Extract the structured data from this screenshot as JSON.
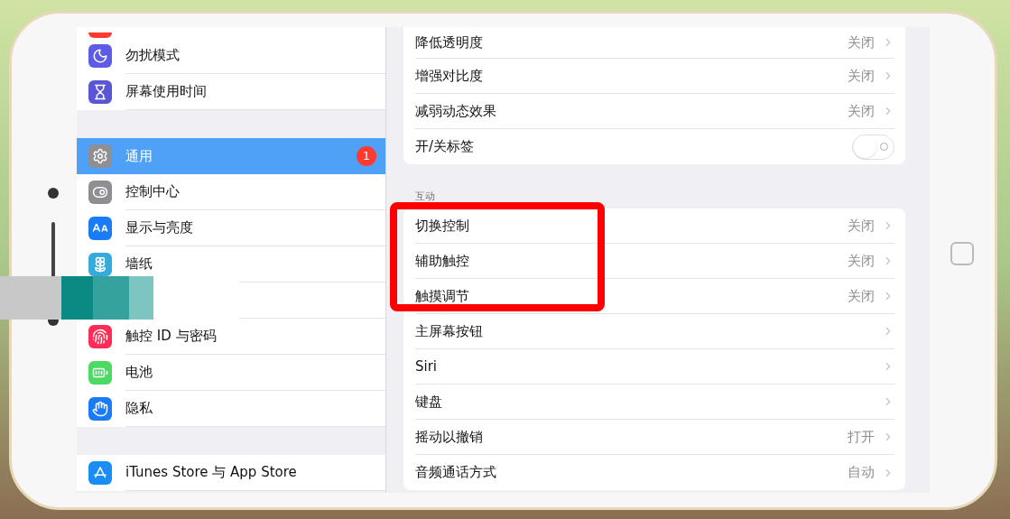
{
  "sidebar": {
    "groups": [
      {
        "items": [
          {
            "selected": false
          },
          {
            "label": "勿扰模式",
            "selected": false
          },
          {
            "label": "屏幕使用时间",
            "selected": false
          }
        ]
      },
      {
        "items": [
          {
            "label": "通用",
            "selected": true,
            "badge": "1"
          },
          {
            "label": "控制中心",
            "selected": false
          },
          {
            "label": "显示与亮度",
            "selected": false
          },
          {
            "label": "墙纸",
            "selected": false
          },
          {
            "label": "触控 ID 与密码",
            "selected": false
          },
          {
            "label": "电池",
            "selected": false
          },
          {
            "label": "隐私",
            "selected": false
          }
        ]
      },
      {
        "items": [
          {
            "label": "iTunes Store 与 App Store",
            "selected": false
          }
        ]
      }
    ]
  },
  "detail": {
    "groups": [
      {
        "rows": [
          {
            "kind": "link",
            "label": "降低透明度",
            "value": "关闭"
          },
          {
            "kind": "link",
            "label": "增强对比度",
            "value": "关闭"
          },
          {
            "kind": "link",
            "label": "减弱动态效果",
            "value": "关闭"
          },
          {
            "kind": "switch",
            "label": "开/关标签",
            "on": false
          }
        ]
      },
      {
        "header": "互动",
        "rows": [
          {
            "kind": "link",
            "label": "切换控制",
            "value": "关闭"
          },
          {
            "kind": "link",
            "label": "辅助触控",
            "value": "关闭"
          },
          {
            "kind": "link",
            "label": "触摸调节",
            "value": "关闭"
          },
          {
            "kind": "link",
            "label": "主屏幕按钮"
          },
          {
            "kind": "link",
            "label": "Siri"
          },
          {
            "kind": "link",
            "label": "键盘"
          },
          {
            "kind": "link",
            "label": "摇动以撤销",
            "value": "打开"
          },
          {
            "kind": "link",
            "label": "音频通话方式",
            "value": "自动"
          }
        ]
      }
    ]
  }
}
